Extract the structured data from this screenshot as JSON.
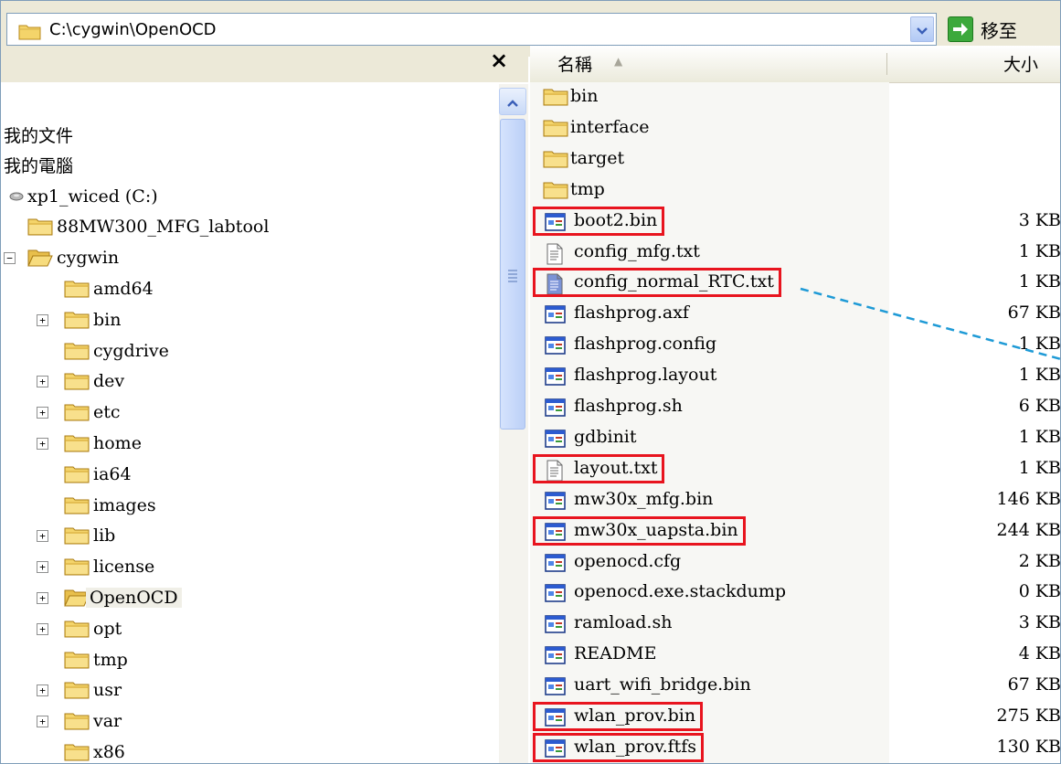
{
  "address_bar": {
    "path": "C:\\cygwin\\OpenOCD",
    "go_label": "移至"
  },
  "left_pane": {
    "close_glyph": "×",
    "tree": [
      {
        "label": "我的文件",
        "depth": -1,
        "expander": "none",
        "icon": "none"
      },
      {
        "label": "我的電腦",
        "depth": -1,
        "expander": "none",
        "icon": "none"
      },
      {
        "label": "xp1_wiced (C:)",
        "depth": 0,
        "expander": "none",
        "icon": "drive-icon"
      },
      {
        "label": "88MW300_MFG_labtool",
        "depth": 1,
        "expander": "none",
        "icon": "folder-icon"
      },
      {
        "label": "cygwin",
        "depth": 1,
        "expander": "minus",
        "icon": "folder-open-icon"
      },
      {
        "label": "amd64",
        "depth": 2,
        "expander": "none",
        "icon": "folder-icon"
      },
      {
        "label": "bin",
        "depth": 2,
        "expander": "plus",
        "icon": "folder-icon"
      },
      {
        "label": "cygdrive",
        "depth": 2,
        "expander": "none",
        "icon": "folder-icon"
      },
      {
        "label": "dev",
        "depth": 2,
        "expander": "plus",
        "icon": "folder-icon"
      },
      {
        "label": "etc",
        "depth": 2,
        "expander": "plus",
        "icon": "folder-icon"
      },
      {
        "label": "home",
        "depth": 2,
        "expander": "plus",
        "icon": "folder-icon"
      },
      {
        "label": "ia64",
        "depth": 2,
        "expander": "none",
        "icon": "folder-icon"
      },
      {
        "label": "images",
        "depth": 2,
        "expander": "none",
        "icon": "folder-icon"
      },
      {
        "label": "lib",
        "depth": 2,
        "expander": "plus",
        "icon": "folder-icon"
      },
      {
        "label": "license",
        "depth": 2,
        "expander": "plus",
        "icon": "folder-icon"
      },
      {
        "label": "OpenOCD",
        "depth": 2,
        "expander": "plus",
        "icon": "folder-open-icon",
        "selected": true
      },
      {
        "label": "opt",
        "depth": 2,
        "expander": "plus",
        "icon": "folder-icon"
      },
      {
        "label": "tmp",
        "depth": 2,
        "expander": "none",
        "icon": "folder-icon"
      },
      {
        "label": "usr",
        "depth": 2,
        "expander": "plus",
        "icon": "folder-icon"
      },
      {
        "label": "var",
        "depth": 2,
        "expander": "plus",
        "icon": "folder-icon"
      },
      {
        "label": "x86",
        "depth": 2,
        "expander": "none",
        "icon": "folder-icon"
      }
    ]
  },
  "right_pane": {
    "columns": {
      "name": "名稱",
      "size": "大小"
    },
    "files": [
      {
        "name": "bin",
        "size": "",
        "type": "folder",
        "highlight": false
      },
      {
        "name": "interface",
        "size": "",
        "type": "folder",
        "highlight": false
      },
      {
        "name": "target",
        "size": "",
        "type": "folder",
        "highlight": false
      },
      {
        "name": "tmp",
        "size": "",
        "type": "folder",
        "highlight": false
      },
      {
        "name": "boot2.bin",
        "size": "3 KB",
        "type": "app",
        "highlight": true
      },
      {
        "name": "config_mfg.txt",
        "size": "1 KB",
        "type": "text",
        "highlight": false
      },
      {
        "name": "config_normal_RTC.txt",
        "size": "1 KB",
        "type": "text-blue",
        "highlight": true
      },
      {
        "name": "flashprog.axf",
        "size": "67 KB",
        "type": "app",
        "highlight": false
      },
      {
        "name": "flashprog.config",
        "size": "1 KB",
        "type": "app",
        "highlight": false
      },
      {
        "name": "flashprog.layout",
        "size": "1 KB",
        "type": "app",
        "highlight": false
      },
      {
        "name": "flashprog.sh",
        "size": "6 KB",
        "type": "app",
        "highlight": false
      },
      {
        "name": "gdbinit",
        "size": "1 KB",
        "type": "app",
        "highlight": false
      },
      {
        "name": "layout.txt",
        "size": "1 KB",
        "type": "text",
        "highlight": true
      },
      {
        "name": "mw30x_mfg.bin",
        "size": "146 KB",
        "type": "app",
        "highlight": false
      },
      {
        "name": "mw30x_uapsta.bin",
        "size": "244 KB",
        "type": "app",
        "highlight": true
      },
      {
        "name": "openocd.cfg",
        "size": "2 KB",
        "type": "app",
        "highlight": false
      },
      {
        "name": "openocd.exe.stackdump",
        "size": "0 KB",
        "type": "app",
        "highlight": false
      },
      {
        "name": "ramload.sh",
        "size": "3 KB",
        "type": "app",
        "highlight": false
      },
      {
        "name": "README",
        "size": "4 KB",
        "type": "app",
        "highlight": false
      },
      {
        "name": "uart_wifi_bridge.bin",
        "size": "67 KB",
        "type": "app",
        "highlight": false
      },
      {
        "name": "wlan_prov.bin",
        "size": "275 KB",
        "type": "app",
        "highlight": true
      },
      {
        "name": "wlan_prov.ftfs",
        "size": "130 KB",
        "type": "app",
        "highlight": true
      }
    ]
  },
  "colors": {
    "highlight_box": "#e8141e",
    "callout_line": "#1e9ad6",
    "folder_yellow": "#f4d46a",
    "chrome_bg": "#ece9d8"
  }
}
